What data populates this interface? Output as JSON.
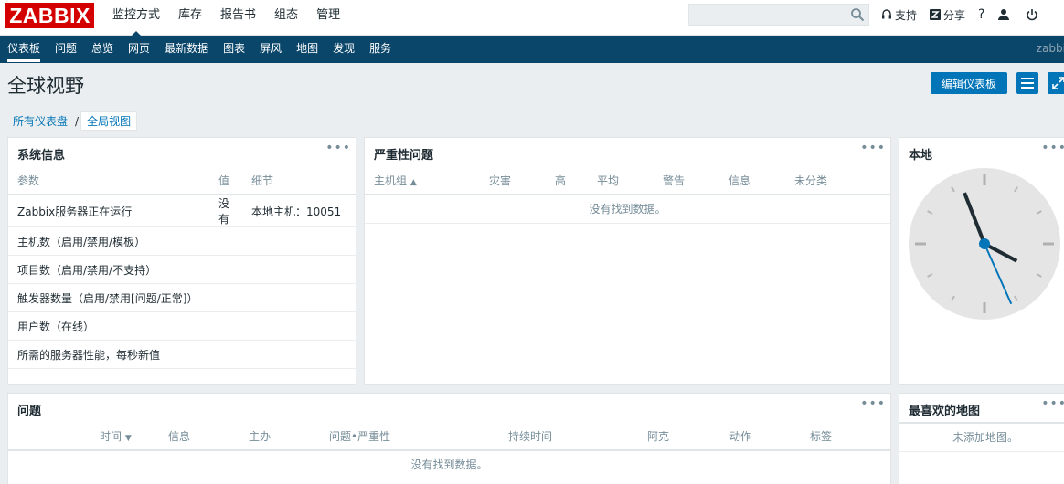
{
  "top": {
    "logo": "ZABBIX",
    "menu": [
      "监控方式",
      "库存",
      "报告书",
      "组态",
      "管理"
    ],
    "search_placeholder": "",
    "support": "支持",
    "share": "分享",
    "help": "?"
  },
  "subnav": {
    "items": [
      "仪表板",
      "问题",
      "总览",
      "网页",
      "最新数据",
      "图表",
      "屏风",
      "地图",
      "发现",
      "服务"
    ],
    "user": "zabbi"
  },
  "header": {
    "title": "全球视野",
    "edit_button": "编辑仪表板"
  },
  "breadcrumb": {
    "all": "所有仪表盘",
    "sep": "/",
    "current": "全局视图"
  },
  "sysinfo": {
    "title": "系统信息",
    "menu": "•••",
    "columns": [
      "参数",
      "值",
      "细节"
    ],
    "rows": [
      {
        "param": "Zabbix服务器正在运行",
        "value": "没有",
        "detail": "本地主机：10051"
      },
      {
        "param": "主机数（启用/禁用/模板）",
        "value": "",
        "detail": ""
      },
      {
        "param": "项目数（启用/禁用/不支持）",
        "value": "",
        "detail": ""
      },
      {
        "param": "触发器数量（启用/禁用[问题/正常]）",
        "value": "",
        "detail": ""
      },
      {
        "param": "用户数（在线）",
        "value": "",
        "detail": ""
      },
      {
        "param": "所需的服务器性能，每秒新值",
        "value": "",
        "detail": ""
      }
    ]
  },
  "severity": {
    "title": "严重性问题",
    "menu": "•••",
    "columns": [
      "主机组",
      "灾害",
      "高",
      "平均",
      "警告",
      "信息",
      "未分类"
    ],
    "sort_arrow": "▲",
    "no_data": "没有找到数据。"
  },
  "local": {
    "title": "本地",
    "menu": "•••",
    "clock": {
      "hour": 3,
      "minute": 56,
      "second": 26
    }
  },
  "problems": {
    "title": "问题",
    "menu": "•••",
    "columns": [
      "时间",
      "信息",
      "主办",
      "问题•严重性",
      "持续时间",
      "阿克",
      "动作",
      "标签"
    ],
    "sort_arrow": "▼",
    "no_data": "没有找到数据。"
  },
  "favmaps": {
    "title": "最喜欢的地图",
    "menu": "•••",
    "empty": "未添加地图。"
  },
  "colors": {
    "brand": "#d40000",
    "nav": "#0a466a",
    "accent": "#0275b8",
    "error": "#e45959"
  }
}
